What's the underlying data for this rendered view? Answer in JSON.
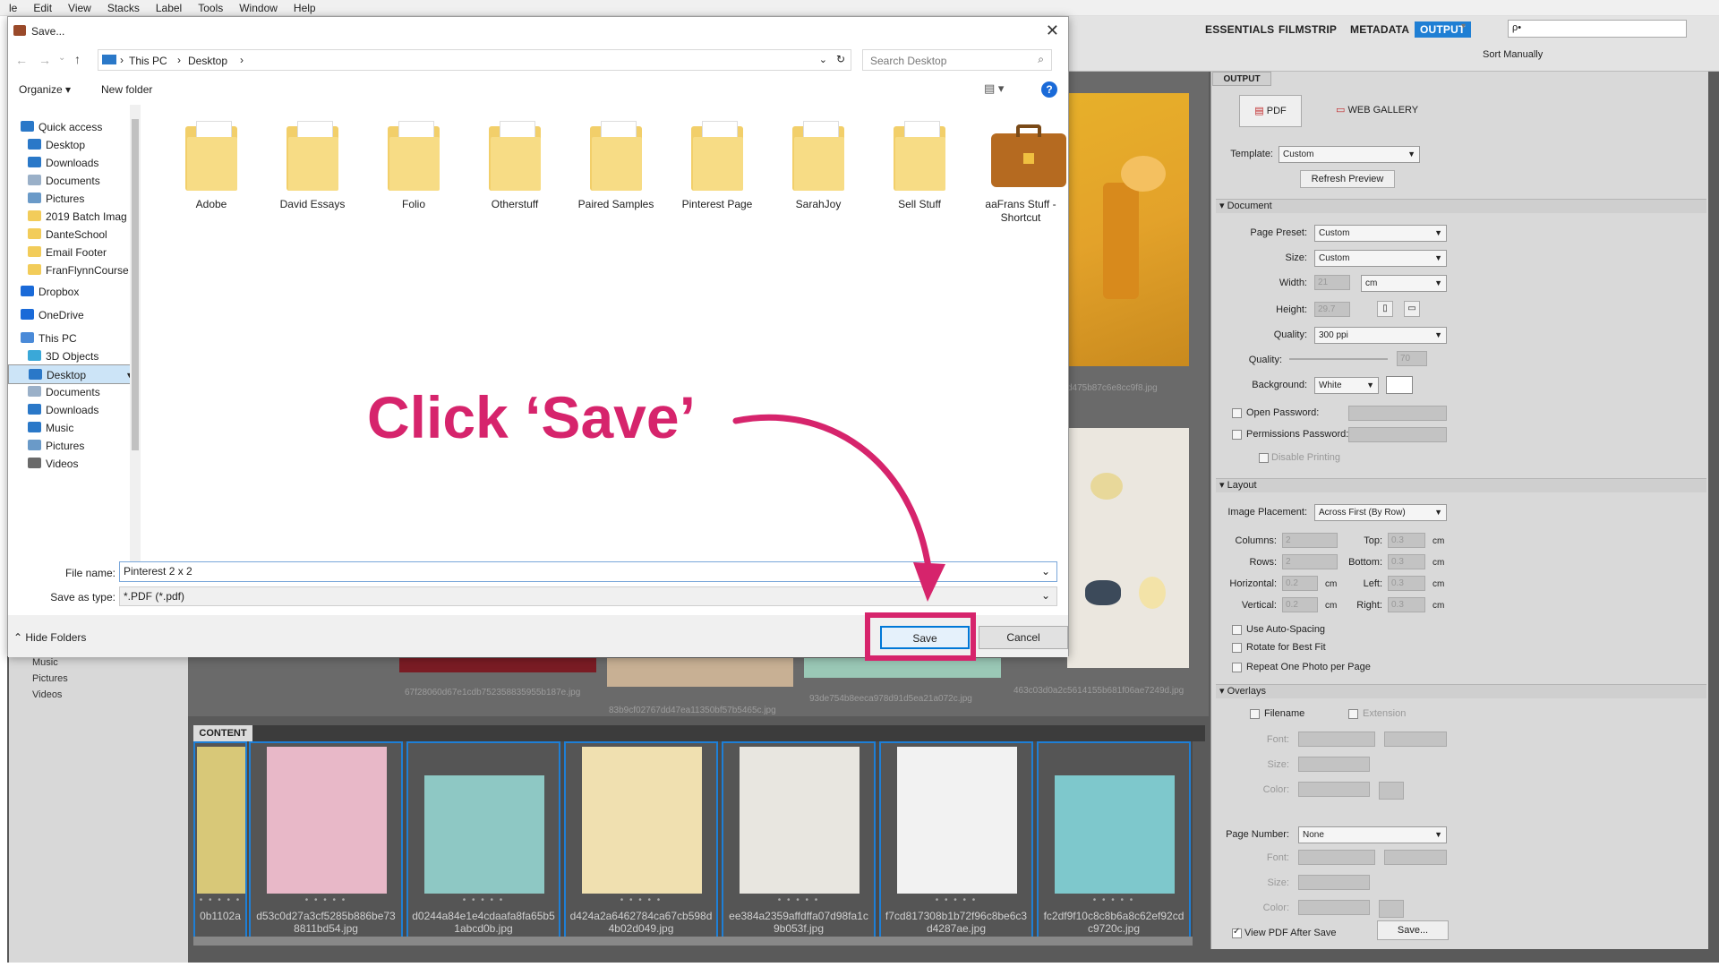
{
  "menubar": [
    "le",
    "Edit",
    "View",
    "Stacks",
    "Label",
    "Tools",
    "Window",
    "Help"
  ],
  "workspaces": {
    "essentials": "ESSENTIALS",
    "filmstrip": "FILMSTRIP",
    "metadata": "METADATA",
    "output": "OUTPUT"
  },
  "toolbar": {
    "search_placeholder": "ρ•",
    "sort_label": "Sort Manually"
  },
  "folders_panel": [
    "Music",
    "Pictures",
    "Videos"
  ],
  "preview_hashes": [
    "d475b87c6e8cc9f8.jpg",
    "67f28060d67e1cdb752358835955b187e.jpg",
    "83b9cf02767dd47ea11350bf57b5465c.jpg",
    "93de754b8eeca978d91d5ea21a072c.jpg",
    "463c03d0a2c5614155b681f06ae7249d.jpg"
  ],
  "content": {
    "tab_label": "CONTENT",
    "thumbs": [
      {
        "name": "0b1102a",
        "color": "#d8c878"
      },
      {
        "name": "d53c0d27a3cf5285b886be738811bd54.jpg",
        "color": "#e8b8c8"
      },
      {
        "name": "d0244a84e1e4cdaafa8fa65b51abcd0b.jpg",
        "color": "#8ec8c4"
      },
      {
        "name": "d424a2a6462784ca67cb598d4b02d049.jpg",
        "color": "#f0e0b0"
      },
      {
        "name": "ee384a2359affdffa07d98fa1c9b053f.jpg",
        "color": "#e8e6e0"
      },
      {
        "name": "f7cd817308b1b72f96c8be6c3d4287ae.jpg",
        "color": "#f2f2f2"
      },
      {
        "name": "fc2df9f10c8c8b6a8c62ef92cdc9720c.jpg",
        "color": "#7ec8cc"
      }
    ]
  },
  "output_panel": {
    "tab": "OUTPUT",
    "pdf_label": "PDF",
    "web_gallery_label": "WEB GALLERY",
    "template_label": "Template:",
    "template_value": "Custom",
    "refresh_label": "Refresh Preview",
    "document_section": "Document",
    "page_preset_label": "Page Preset:",
    "page_preset_value": "Custom",
    "size_label": "Size:",
    "size_value": "Custom",
    "width_label": "Width:",
    "width_value": "21",
    "unit_value": "cm",
    "height_label": "Height:",
    "height_value": "29.7",
    "quality_label": "Quality:",
    "quality_value": "300 ppi",
    "quality2_label": "Quality:",
    "quality2_value": "70",
    "background_label": "Background:",
    "background_value": "White",
    "open_password_label": "Open Password:",
    "permissions_password_label": "Permissions Password:",
    "disable_printing_label": "Disable Printing",
    "layout_section": "Layout",
    "image_placement_label": "Image Placement:",
    "image_placement_value": "Across First (By Row)",
    "columns_label": "Columns:",
    "columns_value": "2",
    "rows_label": "Rows:",
    "rows_value": "2",
    "horizontal_label": "Horizontal:",
    "horizontal_value": "0.2",
    "vertical_label": "Vertical:",
    "vertical_value": "0.2",
    "top_label": "Top:",
    "top_value": "0.3",
    "bottom_label": "Bottom:",
    "bottom_value": "0.3",
    "left_label": "Left:",
    "left_value": "0.3",
    "right_label": "Right:",
    "right_value": "0.3",
    "cm": "cm",
    "use_auto_spacing_label": "Use Auto-Spacing",
    "rotate_label": "Rotate for Best Fit",
    "repeat_label": "Repeat One Photo per Page",
    "overlays_section": "Overlays",
    "filename_label": "Filename",
    "extension_label": "Extension",
    "font_label": "Font:",
    "size2_label": "Size:",
    "color_label": "Color:",
    "page_number_label": "Page Number:",
    "page_number_value": "None",
    "view_pdf_label": "View PDF After Save",
    "save_button": "Save..."
  },
  "dialog": {
    "title": "Save...",
    "breadcrumb": [
      "This PC",
      "Desktop"
    ],
    "search_placeholder": "Search Desktop",
    "organize": "Organize ▾",
    "new_folder": "New folder",
    "nav": [
      {
        "label": "Quick access",
        "color": "#2a78c8"
      },
      {
        "label": "Desktop",
        "color": "#2a78c8"
      },
      {
        "label": "Downloads",
        "color": "#2a78c8"
      },
      {
        "label": "Documents",
        "color": "#9ab0c8"
      },
      {
        "label": "Pictures",
        "color": "#6a9ac8"
      },
      {
        "label": "2019 Batch Imag",
        "color": "#f2cc5a"
      },
      {
        "label": "DanteSchool",
        "color": "#f2cc5a"
      },
      {
        "label": "Email Footer",
        "color": "#f2cc5a"
      },
      {
        "label": "FranFlynnCourse",
        "color": "#f2cc5a"
      },
      {
        "label": "Dropbox",
        "color": "#1a6ad8"
      },
      {
        "label": "OneDrive",
        "color": "#1a6ad8"
      },
      {
        "label": "This PC",
        "color": "#4a8ad8"
      },
      {
        "label": "3D Objects",
        "color": "#3aa8d8"
      },
      {
        "label": "Desktop",
        "color": "#2a78c8"
      },
      {
        "label": "Documents",
        "color": "#9ab0c8"
      },
      {
        "label": "Downloads",
        "color": "#2a78c8"
      },
      {
        "label": "Music",
        "color": "#2a78c8"
      },
      {
        "label": "Pictures",
        "color": "#6a9ac8"
      },
      {
        "label": "Videos",
        "color": "#6a6a6a"
      }
    ],
    "folders": [
      {
        "name": "Adobe"
      },
      {
        "name": "David Essays"
      },
      {
        "name": "Folio"
      },
      {
        "name": "Otherstuff"
      },
      {
        "name": "Paired Samples"
      },
      {
        "name": "Pinterest Page"
      },
      {
        "name": "SarahJoy"
      },
      {
        "name": "Sell Stuff"
      },
      {
        "name": "aaFrans Stuff - Shortcut"
      }
    ],
    "file_name_label": "File name:",
    "file_name_value": "Pinterest 2 x 2",
    "save_as_type_label": "Save as type:",
    "save_as_type_value": "*.PDF (*.pdf)",
    "hide_folders": "Hide Folders",
    "save_button": "Save",
    "cancel_button": "Cancel"
  },
  "annotation": {
    "text": "Click ‘Save’",
    "color": "#d6246c"
  }
}
